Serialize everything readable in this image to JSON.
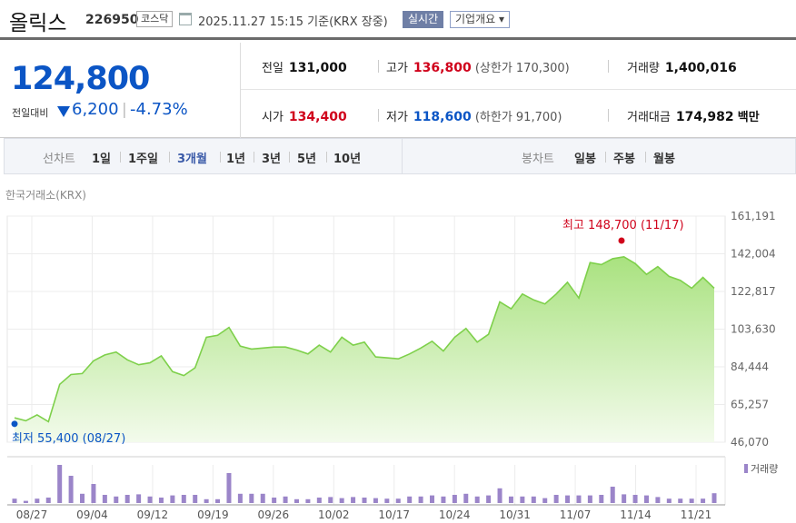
{
  "header": {
    "name": "올릭스",
    "code": "226950",
    "market": "코스닥",
    "datetime": "2025.11.27 15:15  기준(KRX 장중)",
    "realtime_label": "실시간",
    "info_label": "기업개요 ▾"
  },
  "price": {
    "current": "124,800",
    "change_label": "전일대비",
    "change": "6,200",
    "change_pct": "-4.73%"
  },
  "stats": {
    "prev_close_label": "전일",
    "prev_close": "131,000",
    "high_label": "고가",
    "high": "136,800",
    "upper_limit": "(상한가 170,300)",
    "volume_label": "거래량",
    "volume": "1,400,016",
    "open_label": "시가",
    "open": "134,400",
    "low_label": "저가",
    "low": "118,600",
    "lower_limit": "(하한가 91,700)",
    "amount_label": "거래대금",
    "amount": "174,982",
    "amount_unit": "백만"
  },
  "tabs": {
    "line_label": "선차트",
    "line_items": [
      "1일",
      "1주일",
      "3개월",
      "1년",
      "3년",
      "5년",
      "10년"
    ],
    "selected": "3개월",
    "candle_label": "봉차트",
    "candle_items": [
      "일봉",
      "주봉",
      "월봉"
    ]
  },
  "source": "한국거래소(KRX)",
  "colors": {
    "up": "#d0021b",
    "down": "#0b55c5",
    "line": "#7ed04b",
    "volume": "#9b85c9"
  },
  "chart_data": {
    "type": "area",
    "y_ticks": [
      "161,191",
      "142,004",
      "122,817",
      "103,630",
      "84,444",
      "65,257",
      "46,070"
    ],
    "ylim": [
      46070,
      161191
    ],
    "x_ticks": [
      "08/27",
      "09/04",
      "09/12",
      "09/19",
      "09/26",
      "10/02",
      "10/17",
      "10/24",
      "10/31",
      "11/07",
      "11/14",
      "11/21"
    ],
    "max_annotation": "최고 148,700 (11/17)",
    "min_annotation": "최저 55,400 (08/27)",
    "volume_legend": "거래량",
    "series": [
      {
        "values": [
          58500,
          57000,
          60000,
          56500,
          75500,
          80500,
          81000,
          87500,
          90500,
          92000,
          88000,
          85500,
          86500,
          90000,
          82000,
          80000,
          84000,
          99500,
          100500,
          104500,
          95000,
          93500,
          94000,
          94500,
          94500,
          93000,
          91000,
          95500,
          92000,
          99500,
          95500,
          97000,
          89500,
          89000,
          88500,
          91000,
          94000,
          97500,
          92500,
          99500,
          104000,
          97000,
          101000,
          117500,
          114000,
          121500,
          118500,
          116500,
          121500,
          127500,
          119500,
          137500,
          136500,
          139500,
          140500,
          137000,
          131500,
          135500,
          130500,
          128500,
          124500,
          130000,
          124500
        ]
      }
    ],
    "volume": [
      0.08,
      0.04,
      0.08,
      0.1,
      0.7,
      0.5,
      0.17,
      0.35,
      0.15,
      0.12,
      0.15,
      0.16,
      0.12,
      0.1,
      0.14,
      0.15,
      0.15,
      0.07,
      0.07,
      0.55,
      0.17,
      0.17,
      0.17,
      0.1,
      0.12,
      0.07,
      0.07,
      0.1,
      0.11,
      0.09,
      0.11,
      0.1,
      0.09,
      0.08,
      0.08,
      0.12,
      0.12,
      0.14,
      0.12,
      0.15,
      0.17,
      0.12,
      0.14,
      0.27,
      0.12,
      0.12,
      0.12,
      0.09,
      0.15,
      0.14,
      0.14,
      0.14,
      0.15,
      0.3,
      0.16,
      0.15,
      0.14,
      0.11,
      0.08,
      0.08,
      0.08,
      0.08,
      0.18
    ]
  }
}
